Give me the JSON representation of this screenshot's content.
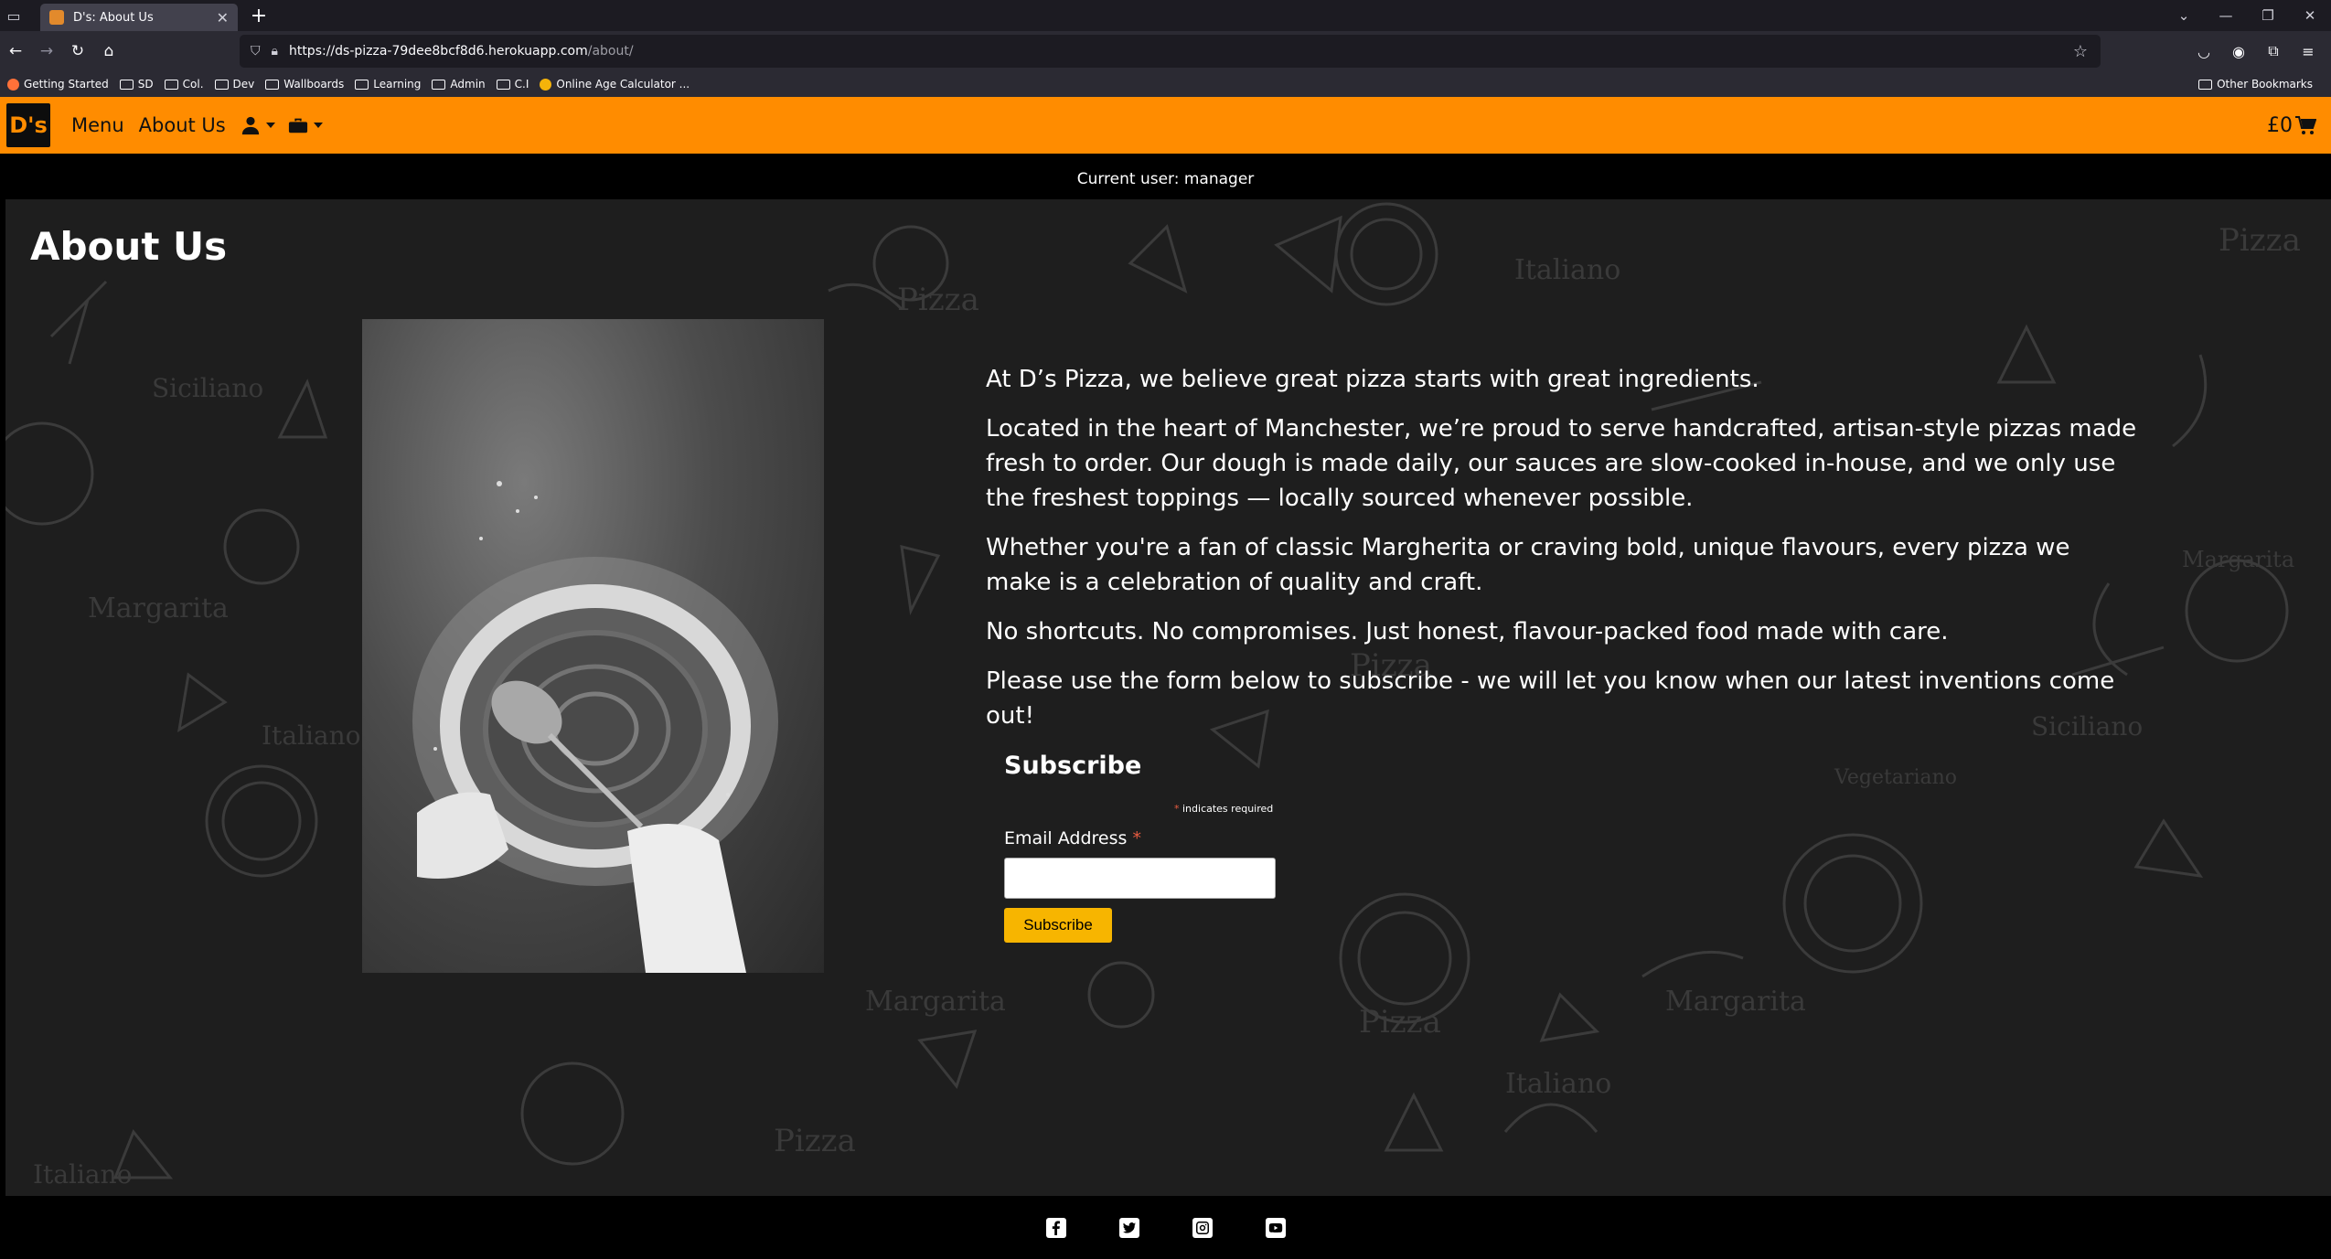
{
  "browser": {
    "tab_title": "D's: About Us",
    "url_host": "https://ds-pizza-79dee8bcf8d6.herokuapp.com",
    "url_path": "/about/",
    "bookmarks": [
      "Getting Started",
      "SD",
      "Col.",
      "Dev",
      "Wallboards",
      "Learning",
      "Admin",
      "C.I",
      "Online Age Calculator ..."
    ],
    "other_bookmarks": "Other Bookmarks"
  },
  "header": {
    "logo_text": "D's",
    "nav": [
      {
        "label": "Menu"
      },
      {
        "label": "About Us"
      }
    ],
    "cart_total": "£0",
    "brand_color": "#ff8c00"
  },
  "user_strip": {
    "text": "Current user: manager"
  },
  "main": {
    "title": "About Us",
    "paragraphs": [
      "At D’s Pizza, we believe great pizza starts with great ingredients.",
      "Located in the heart of Manchester, we’re proud to serve handcrafted, artisan-style pizzas made fresh to order. Our dough is made daily, our sauces are slow-cooked in-house, and we only use the freshest toppings — locally sourced whenever possible.",
      "Whether you're a fan of classic Margherita or craving bold, unique flavours, every pizza we make is a celebration of quality and craft.",
      "No shortcuts. No compromises. Just honest, flavour-packed food made with care.",
      "Please use the form below to subscribe - we will let you know when our latest inventions come out!"
    ],
    "doodle_words": [
      "Pizza",
      "Italiano",
      "Siciliano",
      "Margarita",
      "Pizza",
      "Vegetariano",
      "Margarita",
      "Italiano",
      "Pizza",
      "Margarita",
      "Pizza",
      "Italiano",
      "Pizza",
      "Siciliano",
      "Margarita",
      "Italiano"
    ]
  },
  "subscribe": {
    "title": "Subscribe",
    "required_marker": "*",
    "required_note": "indicates required",
    "email_label": "Email Address",
    "button_label": "Subscribe",
    "button_color": "#f7b500"
  },
  "footer": {
    "icons": [
      "facebook-icon",
      "twitter-icon",
      "instagram-icon",
      "youtube-icon"
    ]
  }
}
